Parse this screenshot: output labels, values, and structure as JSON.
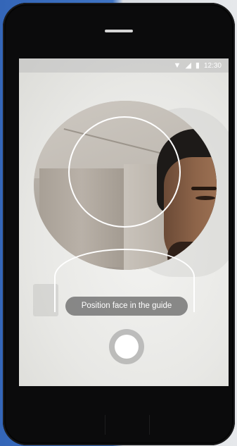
{
  "status_bar": {
    "icons": [
      "wifi-icon",
      "signal-icon",
      "battery-icon"
    ],
    "time": "12:30"
  },
  "camera": {
    "hint_text": "Position face in the guide",
    "shutter_icon": "shutter-icon"
  },
  "colors": {
    "overlay_pill": "#6e6e6e",
    "guide_stroke": "#ffffff",
    "backdrop_blue": "#3466b8"
  }
}
